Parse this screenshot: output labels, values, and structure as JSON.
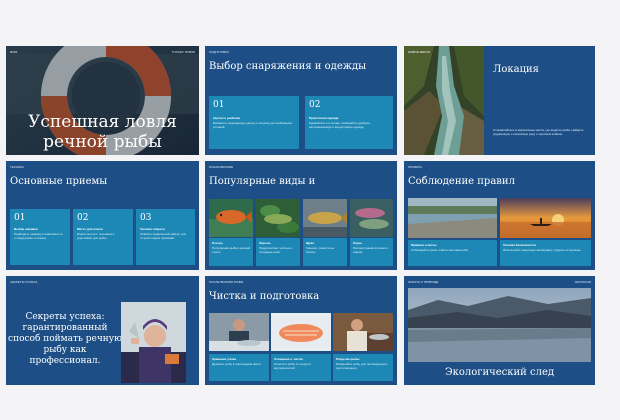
{
  "slides": {
    "s1": {
      "corner_tag": "ВЗЗЗ",
      "corner_right": "ТОЛЬКО ЛОВЛЯ",
      "title_line1": "Успешная ловля",
      "title_line2": "речной рыбы"
    },
    "s2": {
      "tag": "ПОДГОТОВКА",
      "title": "Выбор снаряжения и одежды",
      "cards": [
        {
          "num": "01",
          "title": "Удочки и рыбалка",
          "body": "Выберите подходящую удочку и катушку для выбранных условий"
        },
        {
          "num": "02",
          "title": "Практичная одежда",
          "body": "Одевайтесь по погоде, выбирайте удобную, непромокаемую и водостойкую одежду"
        }
      ]
    },
    "s3": {
      "tag": "НОВОЕ МЕСТО",
      "title": "Локация",
      "body": "Отправляйтесь в живописные места, где водится рыба. Найдите уединённую и спокойную реку с хорошим клёвом."
    },
    "s4": {
      "tag": "ТЕХНИКА",
      "title": "Основные приемы",
      "cards": [
        {
          "num": "01",
          "title": "Выбор наживки",
          "body": "Подберите наживку в зависимости от вида рыбы и сезона"
        },
        {
          "num": "02",
          "title": "Место для ловли",
          "body": "Ищите места с течением и укрытиями для рыбы"
        },
        {
          "num": "03",
          "title": "Техника заброса",
          "body": "Освойте правильный заброс для точной подачи приманки"
        }
      ]
    },
    "s5": {
      "tag": "РАЗНООБРАЗИЕ",
      "title": "Популярные виды и",
      "fish": [
        {
          "name": "Лосось",
          "body": "Популярная рыба в речной ловле"
        },
        {
          "name": "Форель",
          "body": "Предпочитает чистые и холодные реки"
        },
        {
          "name": "Щука",
          "body": "Хищник, ловится на блесну"
        },
        {
          "name": "Окунь",
          "body": "Распространён в реках и озёрах"
        }
      ]
    },
    "s6": {
      "tag": "ПРАВИЛА",
      "title": "Соблюдение правил",
      "cards": [
        {
          "title": "Правила и квоты",
          "body": "Соблюдайте сроки и квоты вылова рыбы"
        },
        {
          "title": "Техника безопасности",
          "body": "Используйте защитную экипировку и будьте осторожны"
        }
      ]
    },
    "s7": {
      "tag": "СЕКРЕТЫ УСПЕХА",
      "lines": [
        "Секреты успеха:",
        "гарантированный",
        "способ поймать речную",
        "рыбу как",
        "профессионал."
      ]
    },
    "s8": {
      "tag": "ПОСЛЕ ВЫЛОВА РЫБЫ",
      "title": "Чистка и подготовка",
      "cards": [
        {
          "title": "Хранение улова",
          "body": "Держите рыбу в прохладном месте"
        },
        {
          "title": "Очищение и чистка",
          "body": "Очистите рыбу от чешуи и внутренностей"
        },
        {
          "title": "Разделка рыбы",
          "body": "Разделайте рыбу для последующего приготовления"
        }
      ]
    },
    "s9": {
      "tag": "ЗАБОТА О ПРИРОДЕ",
      "corner_right": "ЭКОЛОГИЯ",
      "title": "Экологический след"
    }
  }
}
